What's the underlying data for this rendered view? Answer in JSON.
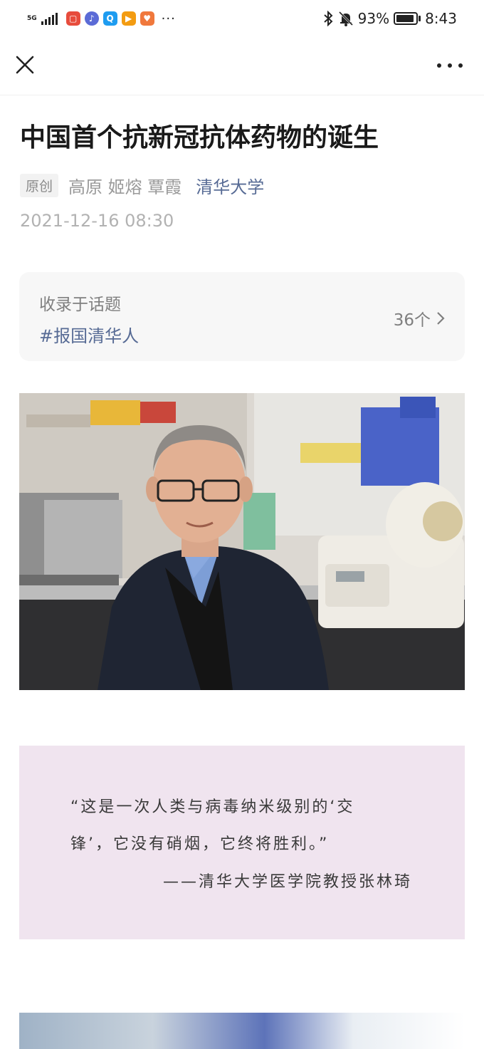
{
  "status_bar": {
    "network": "5G",
    "battery_percent": "93%",
    "time": "8:43",
    "battery_level": 0.93
  },
  "nav": {
    "close_icon": "close-icon",
    "more_icon": "more-dots-icon"
  },
  "article": {
    "title": "中国首个抗新冠抗体药物的诞生",
    "original_tag": "原创",
    "authors": "高原 姬熔 覃霞",
    "account": "清华大学",
    "date": "2021-12-16 08:30"
  },
  "topic": {
    "label": "收录于话题",
    "tag": "#报国清华人",
    "count": "36个"
  },
  "quote": {
    "line1": "“这是一次人类与病毒纳米级别的‘交",
    "line2": "锋’，它没有硝烟，它终将胜利。”",
    "attribution": "——清华大学医学院教授张林琦"
  },
  "colors": {
    "link": "#576b95",
    "quote_bg": "#f0e4ef",
    "card_bg": "#f7f7f7"
  }
}
